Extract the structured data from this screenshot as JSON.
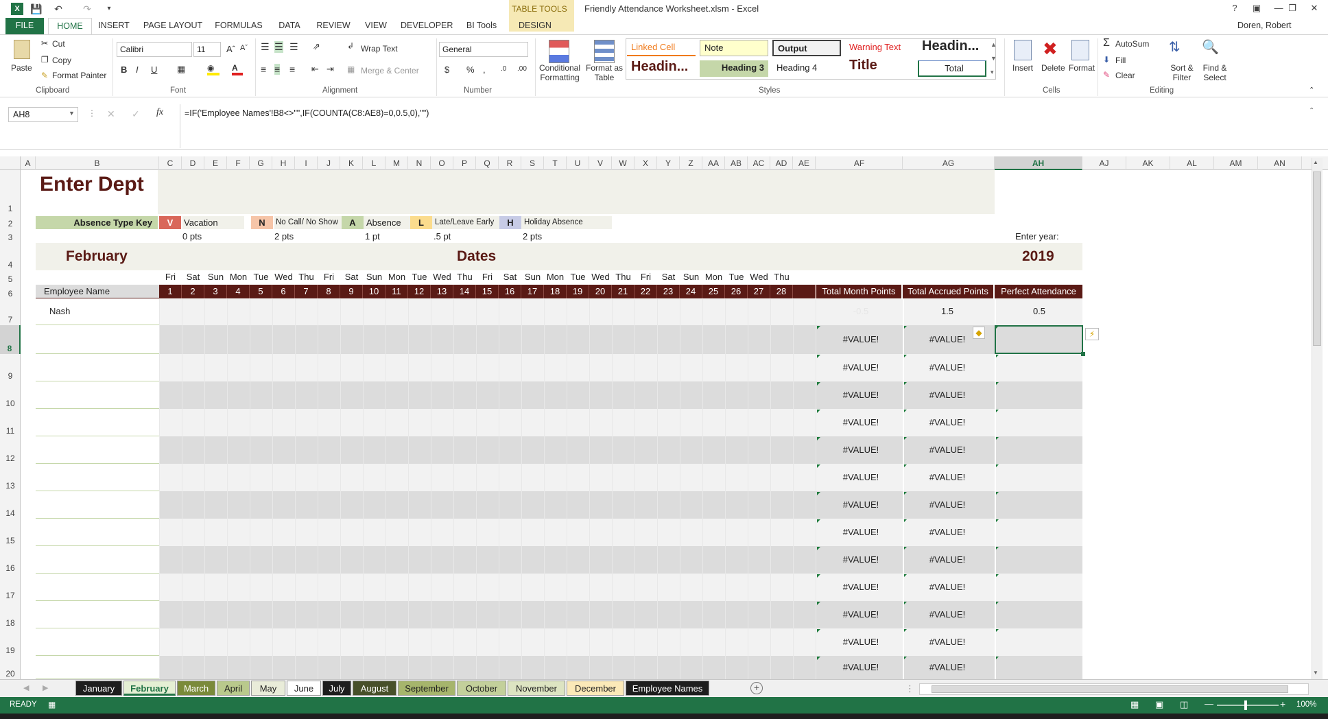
{
  "window": {
    "title": "Friendly Attendance Worksheet.xlsm - Excel",
    "context_tab_group": "TABLE TOOLS",
    "user": "Doren, Robert"
  },
  "ribbon_tabs": [
    "FILE",
    "HOME",
    "INSERT",
    "PAGE LAYOUT",
    "FORMULAS",
    "DATA",
    "REVIEW",
    "VIEW",
    "DEVELOPER",
    "BI Tools",
    "DESIGN"
  ],
  "clipboard": {
    "paste": "Paste",
    "cut": "Cut",
    "copy": "Copy",
    "format_painter": "Format Painter",
    "group": "Clipboard"
  },
  "font": {
    "name": "Calibri",
    "size": "11",
    "group": "Font"
  },
  "alignment": {
    "wrap": "Wrap Text",
    "merge": "Merge & Center",
    "group": "Alignment"
  },
  "number": {
    "format": "General",
    "group": "Number"
  },
  "styles": {
    "conditional": "Conditional Formatting",
    "format_table": "Format as Table",
    "cells": [
      "Linked Cell",
      "Note",
      "Output",
      "Warning Text",
      "Headin...",
      "Headin...",
      "Heading 3",
      "Heading 4",
      "Title",
      "Total"
    ],
    "group": "Styles"
  },
  "cells_group": {
    "insert": "Insert",
    "delete": "Delete",
    "format": "Format",
    "group": "Cells"
  },
  "editing": {
    "autosum": "AutoSum",
    "fill": "Fill",
    "clear": "Clear",
    "sort": "Sort & Filter",
    "find": "Find & Select",
    "group": "Editing"
  },
  "formula_bar": {
    "name_box": "AH8",
    "fx": "fx",
    "formula": "=IF('Employee Names'!B8<>\"\",IF(COUNTA(C8:AE8)=0,0.5,0),\"\")"
  },
  "columns": [
    "A",
    "B",
    "C",
    "D",
    "E",
    "F",
    "G",
    "H",
    "I",
    "J",
    "K",
    "L",
    "M",
    "N",
    "O",
    "P",
    "Q",
    "R",
    "S",
    "T",
    "U",
    "V",
    "W",
    "X",
    "Y",
    "Z",
    "AA",
    "AB",
    "AC",
    "AD",
    "AE",
    "AF",
    "AG",
    "AH",
    "AJ",
    "AK",
    "AL",
    "AM",
    "AN"
  ],
  "rows": [
    "1",
    "2",
    "3",
    "4",
    "5",
    "6",
    "7",
    "8",
    "9",
    "10",
    "11",
    "12",
    "13",
    "14",
    "15",
    "16",
    "17",
    "18",
    "19",
    "20"
  ],
  "sheet": {
    "dept": "Enter Dept",
    "key_label": "Absence Type Key",
    "key": [
      {
        "code": "V",
        "label": "Vacation",
        "pts": "0 pts",
        "color": "#d9675a"
      },
      {
        "code": "N",
        "label": "No Call/ No Show",
        "pts": "2 pts",
        "color": "#f6c5a8"
      },
      {
        "code": "A",
        "label": "Absence",
        "pts": "1 pt",
        "color": "#c5d7a9"
      },
      {
        "code": "L",
        "label": "Late/Leave Early",
        "pts": ".5 pt",
        "color": "#fbdc8d"
      },
      {
        "code": "H",
        "label": "Holiday Absence",
        "pts": "2 pts",
        "color": "#c7cbe6"
      }
    ],
    "enter_year": "Enter year:",
    "month": "February",
    "dates_label": "Dates",
    "year": "2019",
    "employee_header": "Employee Name",
    "day_names": [
      "Fri",
      "Sat",
      "Sun",
      "Mon",
      "Tue",
      "Wed",
      "Thu",
      "Fri",
      "Sat",
      "Sun",
      "Mon",
      "Tue",
      "Wed",
      "Thu",
      "Fri",
      "Sat",
      "Sun",
      "Mon",
      "Tue",
      "Wed",
      "Thu",
      "Fri",
      "Sat",
      "Sun",
      "Mon",
      "Tue",
      "Wed",
      "Thu"
    ],
    "day_numbers": [
      "1",
      "2",
      "3",
      "4",
      "5",
      "6",
      "7",
      "8",
      "9",
      "10",
      "11",
      "12",
      "13",
      "14",
      "15",
      "16",
      "17",
      "18",
      "19",
      "20",
      "21",
      "22",
      "23",
      "24",
      "25",
      "26",
      "27",
      "28"
    ],
    "totals_headers": [
      "Total Month Points",
      "Total Accrued Points",
      "Perfect Attendance"
    ],
    "employee": "Nash",
    "row7": [
      "-0.5",
      "1.5",
      "0.5"
    ],
    "error_value": "#VALUE!"
  },
  "sheet_tabs": [
    {
      "name": "January",
      "bg": "#1e1e1e",
      "fg": "#fff"
    },
    {
      "name": "February",
      "bg": "#e5efd4",
      "fg": "#217346",
      "active": true
    },
    {
      "name": "March",
      "bg": "#7a8a3a",
      "fg": "#fff"
    },
    {
      "name": "April",
      "bg": "#b9c98c",
      "fg": "#222"
    },
    {
      "name": "May",
      "bg": "#e9ecd9",
      "fg": "#222"
    },
    {
      "name": "June",
      "bg": "#fff",
      "fg": "#222"
    },
    {
      "name": "July",
      "bg": "#1e1e1e",
      "fg": "#fff"
    },
    {
      "name": "August",
      "bg": "#48502a",
      "fg": "#fff"
    },
    {
      "name": "September",
      "bg": "#a6b56c",
      "fg": "#222"
    },
    {
      "name": "October",
      "bg": "#c3d09b",
      "fg": "#222"
    },
    {
      "name": "November",
      "bg": "#dde4c2",
      "fg": "#222"
    },
    {
      "name": "December",
      "bg": "#fbe9b8",
      "fg": "#222"
    },
    {
      "name": "Employee Names",
      "bg": "#1e1e1e",
      "fg": "#fff"
    }
  ],
  "status": {
    "ready": "READY",
    "zoom": "100%"
  }
}
